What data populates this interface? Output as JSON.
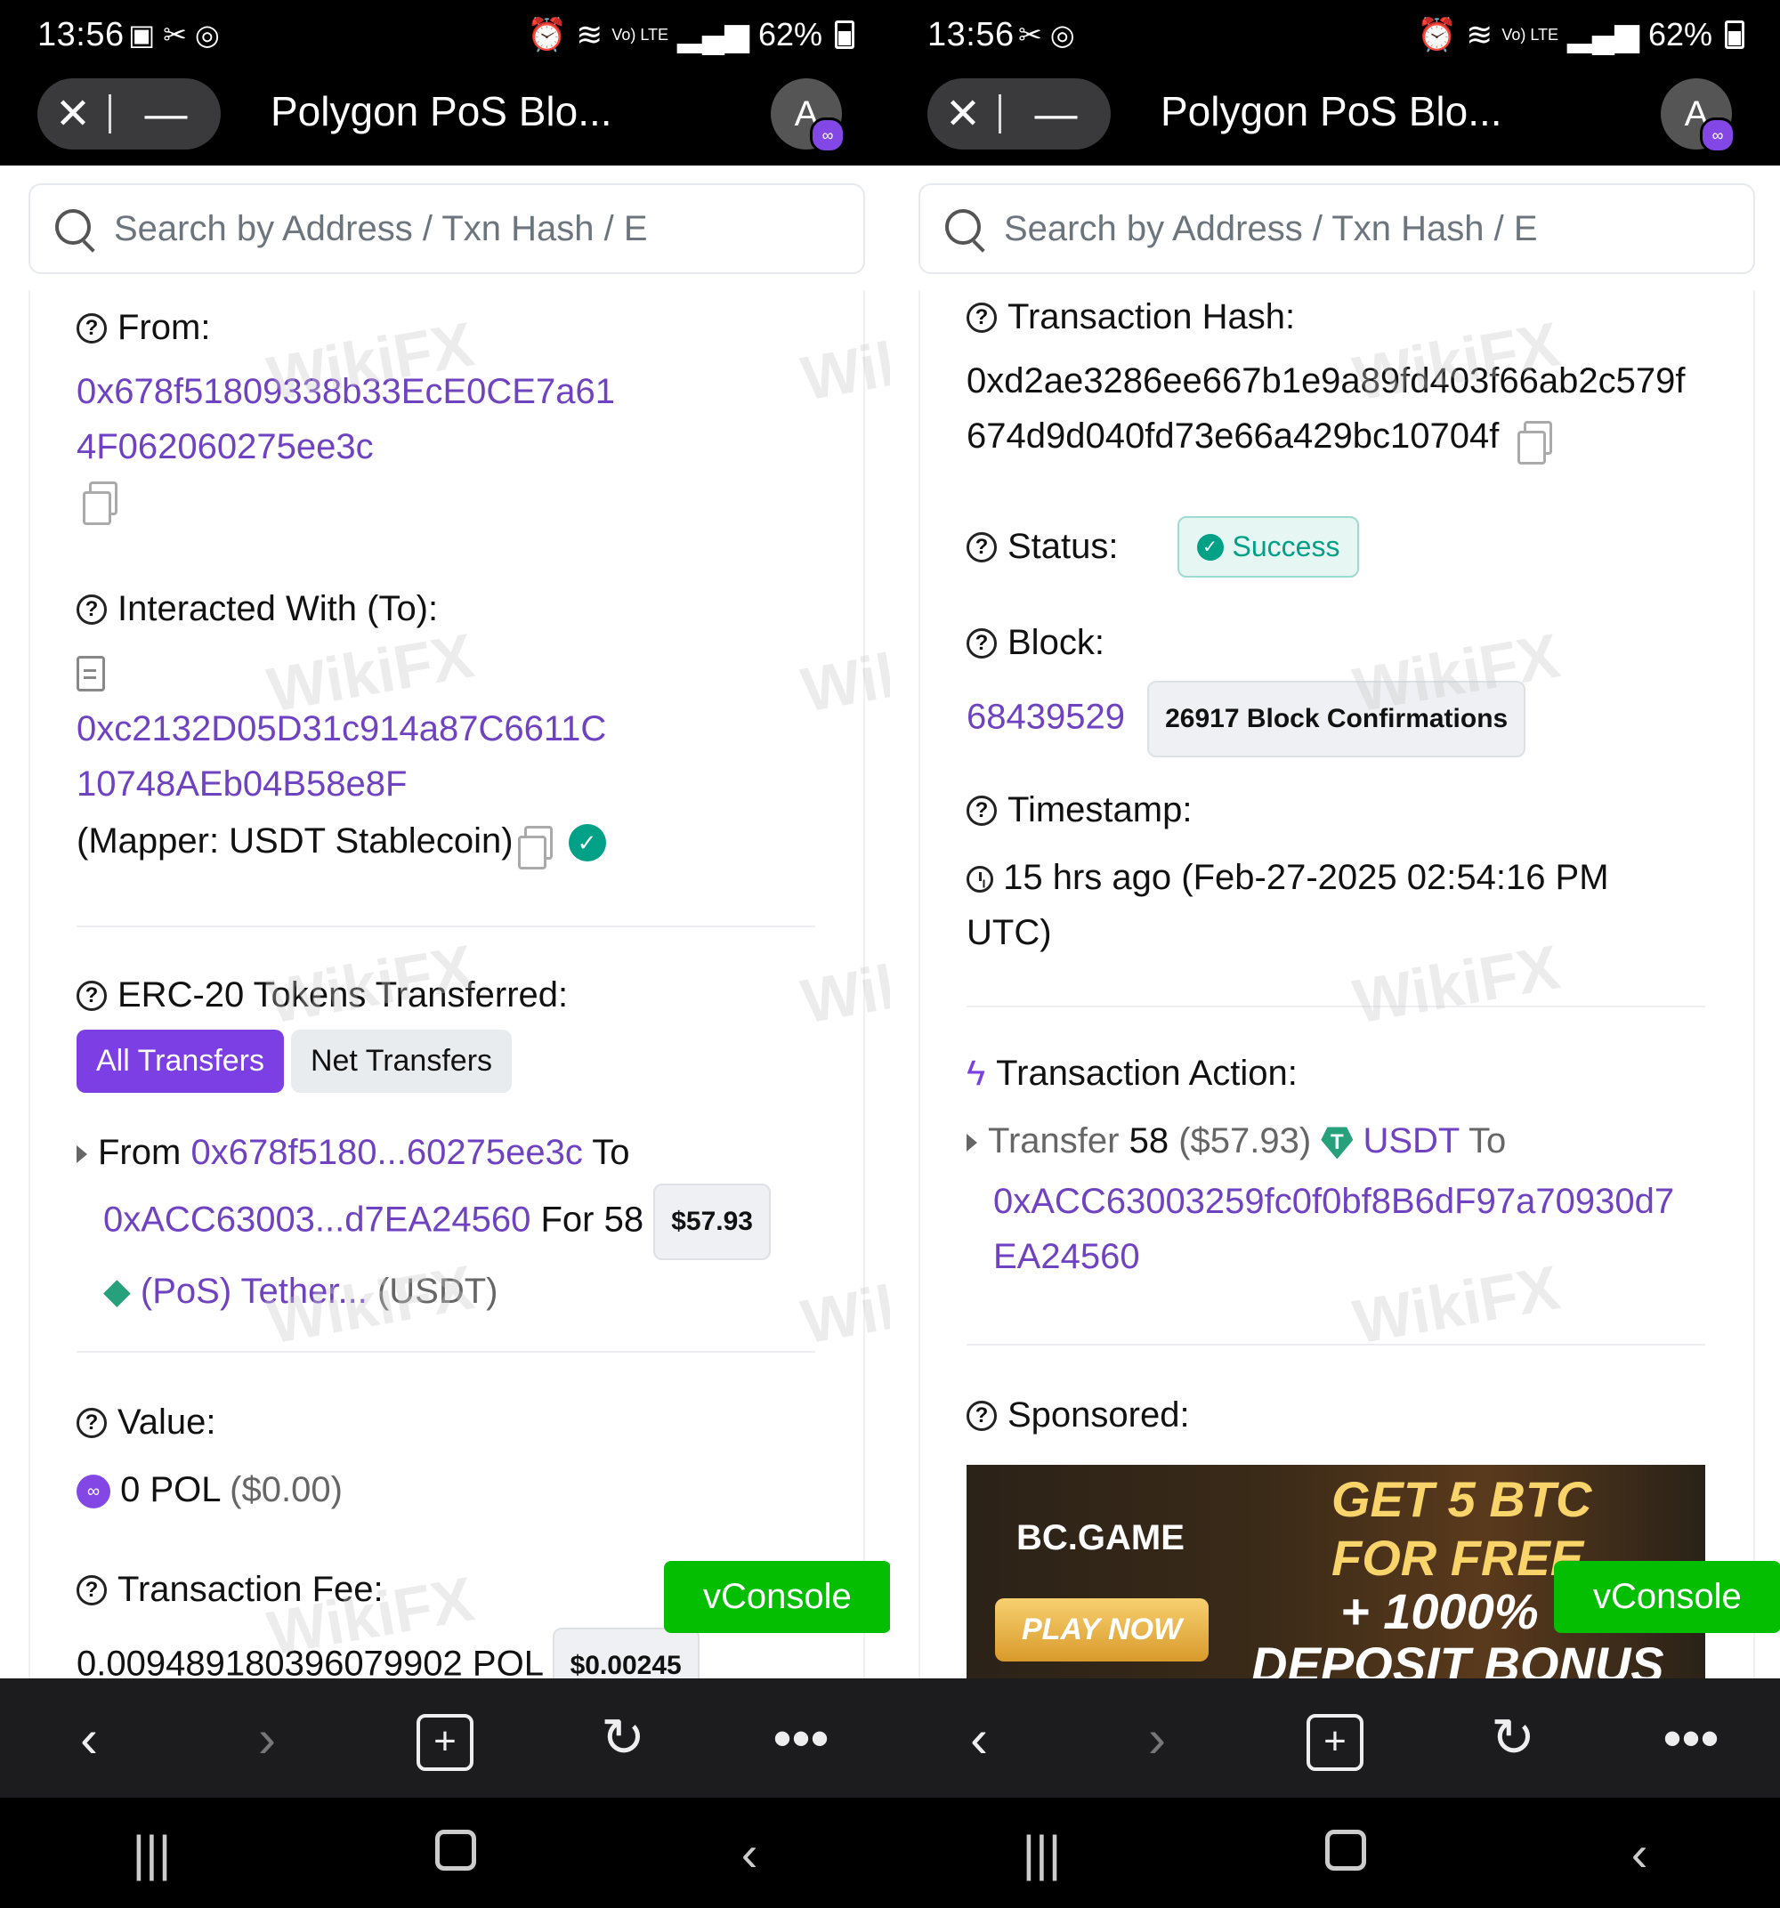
{
  "status_bar": {
    "time": "13:56",
    "icons_left": [
      "image-icon",
      "missed-call-icon",
      "chrome-icon"
    ],
    "signal_text": "Vo) LTE",
    "battery": "62%"
  },
  "browser": {
    "tab_title": "Polygon PoS Blo...",
    "avatar_letter": "A",
    "close_label": "✕",
    "minimize_label": "—",
    "search_placeholder": "Search by Address / Txn Hash / E"
  },
  "left": {
    "from_label": "From:",
    "from_address": "0x678f51809338b33EcE0CE7a614F062060275ee3c",
    "to_label": "Interacted With (To):",
    "to_address": "0xc2132D05D31c914a87C6611C10748AEb04B58e8F",
    "to_note": "(Mapper: USDT Stablecoin)",
    "erc20_label": "ERC-20 Tokens Transferred:",
    "tabs": [
      "All Transfers",
      "Net Transfers"
    ],
    "transfer": {
      "from_word": "From",
      "from_short": "0x678f5180...60275ee3c",
      "to_word": "To",
      "to_short": "0xACC63003...d7EA24560",
      "for_word": "For",
      "amount": "58",
      "usd": "$57.93",
      "token": "(PoS) Tether...",
      "symbol": "(USDT)"
    },
    "value_label": "Value:",
    "value_amount": "0 POL",
    "value_usd": "($0.00)",
    "fee_label": "Transaction Fee:",
    "fee_amount": "0.009489180396079902 POL",
    "fee_usd": "$0.00245"
  },
  "right": {
    "hash_label": "Transaction Hash:",
    "hash_value": "0xd2ae3286ee667b1e9a89fd403f66ab2c579f674d9d040fd73e66a429bc10704f",
    "status_label": "Status:",
    "status_value": "Success",
    "block_label": "Block:",
    "block_number": "68439529",
    "block_confirmations": "26917 Block Confirmations",
    "timestamp_label": "Timestamp:",
    "timestamp_value": "15 hrs ago (Feb-27-2025 02:54:16 PM UTC)",
    "action_label": "Transaction Action:",
    "action": {
      "verb": "Transfer",
      "amount": "58",
      "usd": "($57.93)",
      "token": "USDT",
      "to_word": "To",
      "to_address": "0xACC63003259fc0f0bf8B6dF97a70930d7EA24560"
    },
    "sponsored_label": "Sponsored:",
    "ad": {
      "brand": "BC.GAME",
      "play": "PLAY NOW",
      "line1": "GET 5 BTC",
      "line2": "FOR FREE",
      "line3": "+ 1000%",
      "line4": "DEPOSIT BONUS"
    }
  },
  "vconsole_label": "vConsole",
  "watermark": "WikiFX",
  "colors": {
    "link": "#6f42c1",
    "primary": "#7b3fe4",
    "success": "#00a186",
    "vconsole": "#04be02"
  }
}
